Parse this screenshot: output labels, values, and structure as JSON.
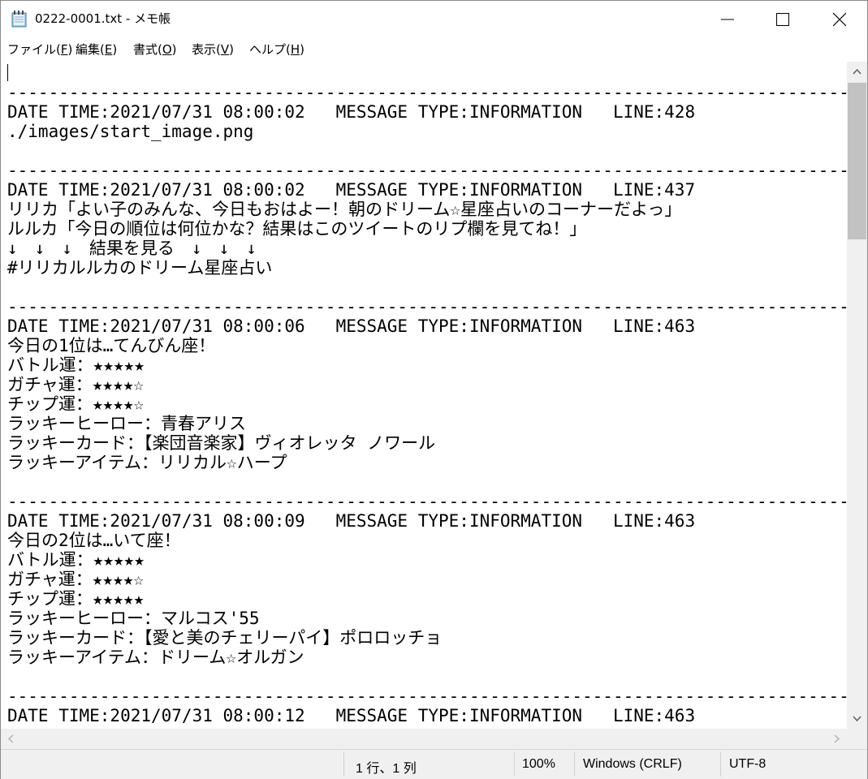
{
  "window": {
    "title": "0222-0001.txt - メモ帳",
    "icon": "notepad-icon"
  },
  "menu": [
    {
      "label": "ファイル(",
      "key": "F",
      "tail": ")"
    },
    {
      "label": "編集(",
      "key": "E",
      "tail": ")"
    },
    {
      "label": "書式(",
      "key": "O",
      "tail": ")"
    },
    {
      "label": "表示(",
      "key": "V",
      "tail": ")"
    },
    {
      "label": "ヘルプ(",
      "key": "H",
      "tail": ")"
    }
  ],
  "editor": {
    "lines": [
      "----------------------------------------------------------------------------------",
      "DATE TIME:2021/07/31 08:00:02   MESSAGE TYPE:INFORMATION   LINE:428",
      "./images/start_image.png",
      "",
      "----------------------------------------------------------------------------------",
      "DATE TIME:2021/07/31 08:00:02   MESSAGE TYPE:INFORMATION   LINE:437",
      "リリカ「よい子のみんな、今日もおはよー！朝のドリーム☆星座占いのコーナーだよっ」",
      "ルルカ「今日の順位は何位かな？結果はこのツイートのリプ欄を見てね！」",
      "↓　↓　↓　結果を見る　↓　↓　↓",
      "#リリカルルカのドリーム星座占い",
      "",
      "----------------------------------------------------------------------------------",
      "DATE TIME:2021/07/31 08:00:06   MESSAGE TYPE:INFORMATION   LINE:463",
      "今日の1位は…てんびん座！",
      "バトル運：★★★★★",
      "ガチャ運：★★★★☆",
      "チップ運：★★★★☆",
      "ラッキーヒーロー：青春アリス",
      "ラッキーカード：【楽団音楽家】ヴィオレッタ ノワール",
      "ラッキーアイテム：リリカル☆ハープ",
      "",
      "----------------------------------------------------------------------------------",
      "DATE TIME:2021/07/31 08:00:09   MESSAGE TYPE:INFORMATION   LINE:463",
      "今日の2位は…いて座！",
      "バトル運：★★★★★",
      "ガチャ運：★★★★☆",
      "チップ運：★★★★★",
      "ラッキーヒーロー：マルコス'55",
      "ラッキーカード：【愛と美のチェリーパイ】ポロロッチョ",
      "ラッキーアイテム：ドリーム☆オルガン",
      "",
      "----------------------------------------------------------------------------------",
      "DATE TIME:2021/07/31 08:00:12   MESSAGE TYPE:INFORMATION   LINE:463"
    ]
  },
  "status": {
    "position": "1 行、1 列",
    "zoom": "100%",
    "line_ending": "Windows (CRLF)",
    "encoding": "UTF-8"
  }
}
